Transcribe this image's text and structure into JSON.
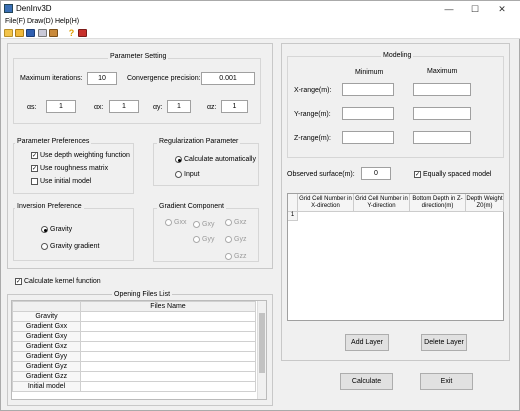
{
  "window": {
    "title": "DenInv3D",
    "minimize": "—",
    "maximize": "☐",
    "close": "✕"
  },
  "menu": [
    "File(F)",
    "Draw(D)",
    "Help(H)"
  ],
  "toolbar_icons": [
    "open-icon",
    "folder-icon",
    "save-icon",
    "copy-icon",
    "cube-icon",
    "help-icon",
    "exit-icon"
  ],
  "param": {
    "title": "Parameter Setting",
    "max_iter_label": "Maximum iterations:",
    "max_iter_value": "10",
    "conv_label": "Convergence precision:",
    "conv_value": "0.001",
    "as_label": "αs:",
    "as_value": "1",
    "ax_label": "αx:",
    "ax_value": "1",
    "ay_label": "αy:",
    "ay_value": "1",
    "az_label": "αz:",
    "az_value": "1"
  },
  "prefs": {
    "title": "Parameter Preferences",
    "depth": "Use depth weighting function",
    "rough": "Use roughness matrix",
    "initial": "Use initial model"
  },
  "reg": {
    "title": "Regularization Parameter",
    "auto": "Calculate automatically",
    "input": "Input"
  },
  "inv": {
    "title": "Inversion Preference",
    "gravity": "Gravity",
    "gradient": "Gravity gradient"
  },
  "gradcomp": {
    "title": "Gradient Component",
    "gxx": "Gxx",
    "gxy": "Gxy",
    "gxz": "Gxz",
    "gyy": "Gyy",
    "gyz": "Gyz",
    "gzz": "Gzz"
  },
  "kernel": "Calculate kernel function",
  "files": {
    "title": "Opening Files List",
    "col": "Files Name",
    "rows": [
      "Gravity",
      "Gradient Gxx",
      "Gradient Gxy",
      "Gradient Gxz",
      "Gradient Gyy",
      "Gradient Gyz",
      "Gradient Gzz",
      "Initial model"
    ]
  },
  "modeling": {
    "title": "Modeling",
    "min": "Minimum",
    "max": "Maximum",
    "x": "X-range(m):",
    "y": "Y-range(m):",
    "z": "Z-range(m):",
    "observed_label": "Observed surface(m):",
    "observed_value": "0",
    "equal": "Equally spaced model"
  },
  "grid": {
    "headers": [
      "Grid Cell Number in X-direction",
      "Grid Cell Number in Y-direction",
      "Bottom Depth in Z-direction(m)",
      "Depth Weight Z0(m)"
    ],
    "row1": "1"
  },
  "buttons": {
    "add": "Add Layer",
    "delete": "Delete Layer",
    "calc": "Calculate",
    "exit": "Exit"
  }
}
